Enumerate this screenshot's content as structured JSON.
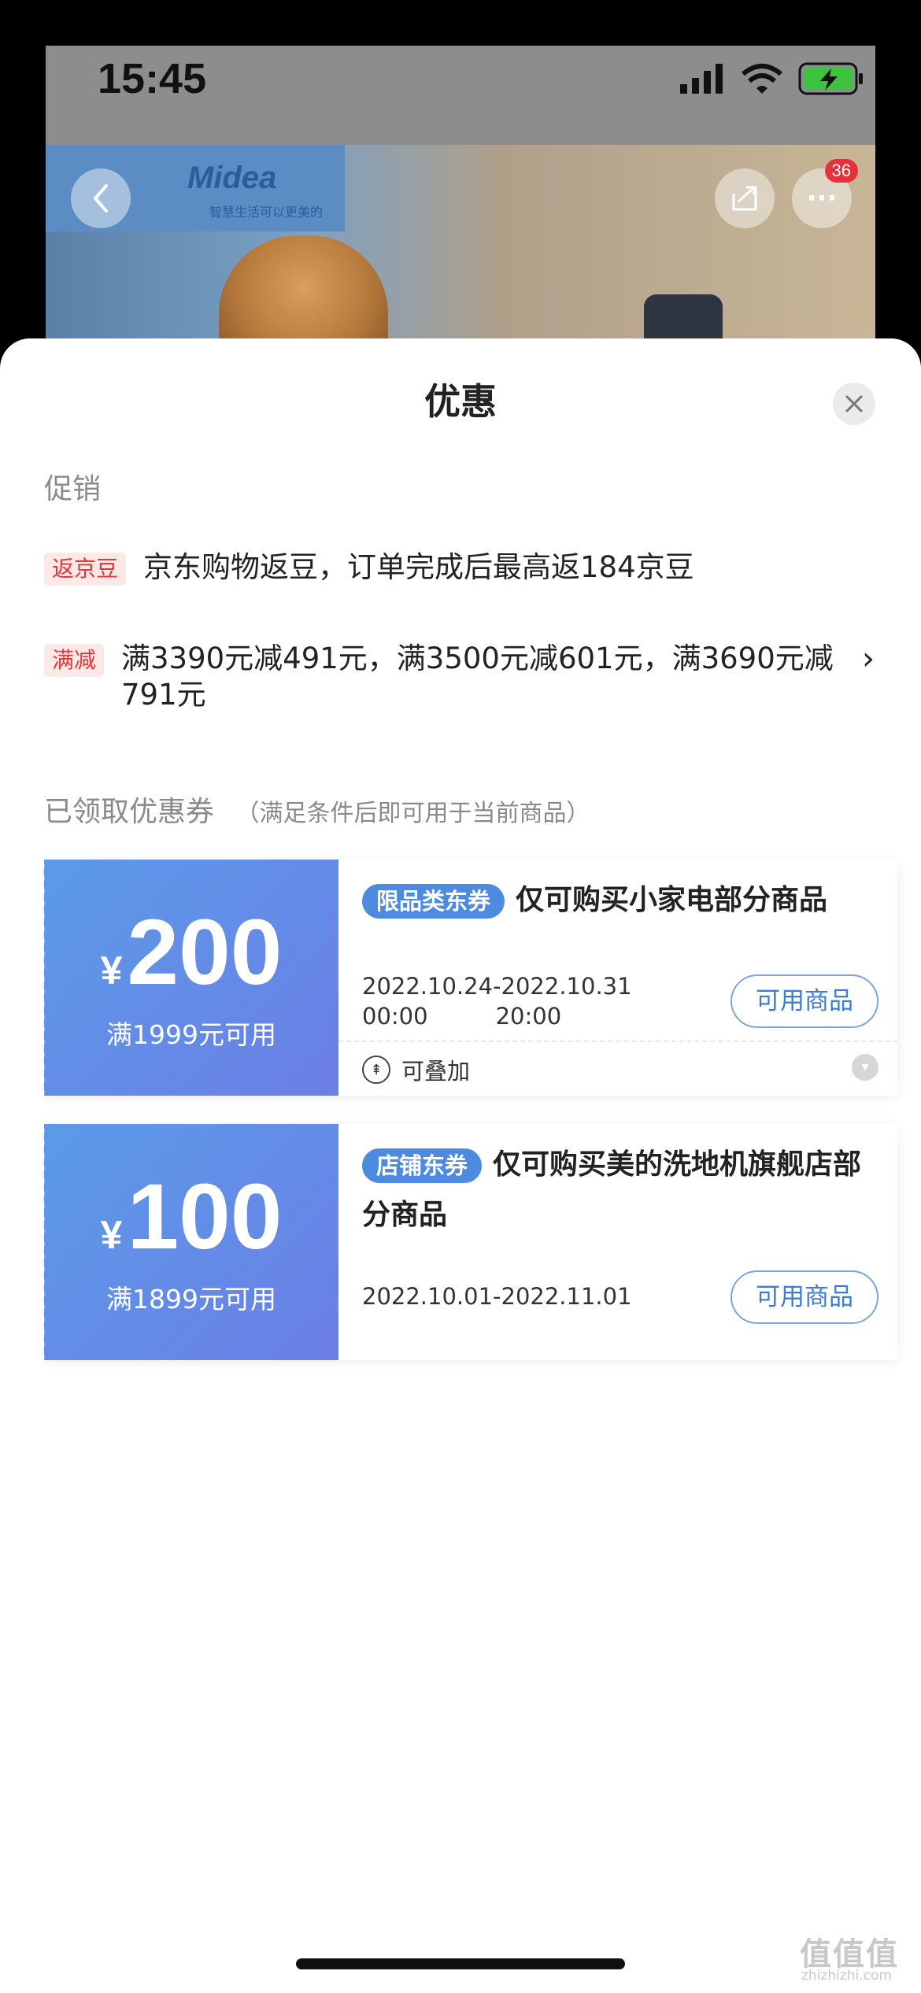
{
  "status_bar": {
    "time": "15:45",
    "icons": [
      "signal-icon",
      "wifi-icon",
      "battery-charging-icon"
    ]
  },
  "background_page": {
    "brand": "Midea",
    "brand_slogan": "智慧生活可以更美的",
    "cart_badge": "36",
    "icons": [
      "back-icon",
      "share-icon",
      "more-icon"
    ]
  },
  "sheet": {
    "title": "优惠",
    "promotions_label": "促销",
    "promotions": [
      {
        "tag": "返京豆",
        "text": "京东购物返豆，订单完成后最高返184京豆"
      },
      {
        "tag": "满减",
        "text": "满3390元减491元，满3500元减601元，满3690元减791元"
      }
    ],
    "coupons_label": "已领取优惠券",
    "coupons_note": "（满足条件后即可用于当前商品）",
    "coupons": [
      {
        "yen": "¥",
        "amount": "200",
        "min_use": "满1999元可用",
        "tag": "限品类东券",
        "title": "仅可购买小家电部分商品",
        "date_start": "2022.10.24",
        "date_start_time": "00:00",
        "date_sep": "-",
        "date_end": "2022.10.31",
        "date_end_time": "20:00",
        "button": "可用商品",
        "stack_label": "可叠加"
      },
      {
        "yen": "¥",
        "amount": "100",
        "min_use": "满1899元可用",
        "tag": "店铺东券",
        "title": "仅可购买美的洗地机旗舰店部分商品",
        "date_range": "2022.10.01-2022.11.01",
        "button": "可用商品"
      }
    ]
  },
  "watermark": {
    "text": "值值值",
    "url": "zhizhizhi.com"
  },
  "colors": {
    "accent_blue": "#4d8be0",
    "red_tag": "#e4393c",
    "coupon_gradient_start": "#5b9be8",
    "coupon_gradient_end": "#6b7ee6"
  }
}
